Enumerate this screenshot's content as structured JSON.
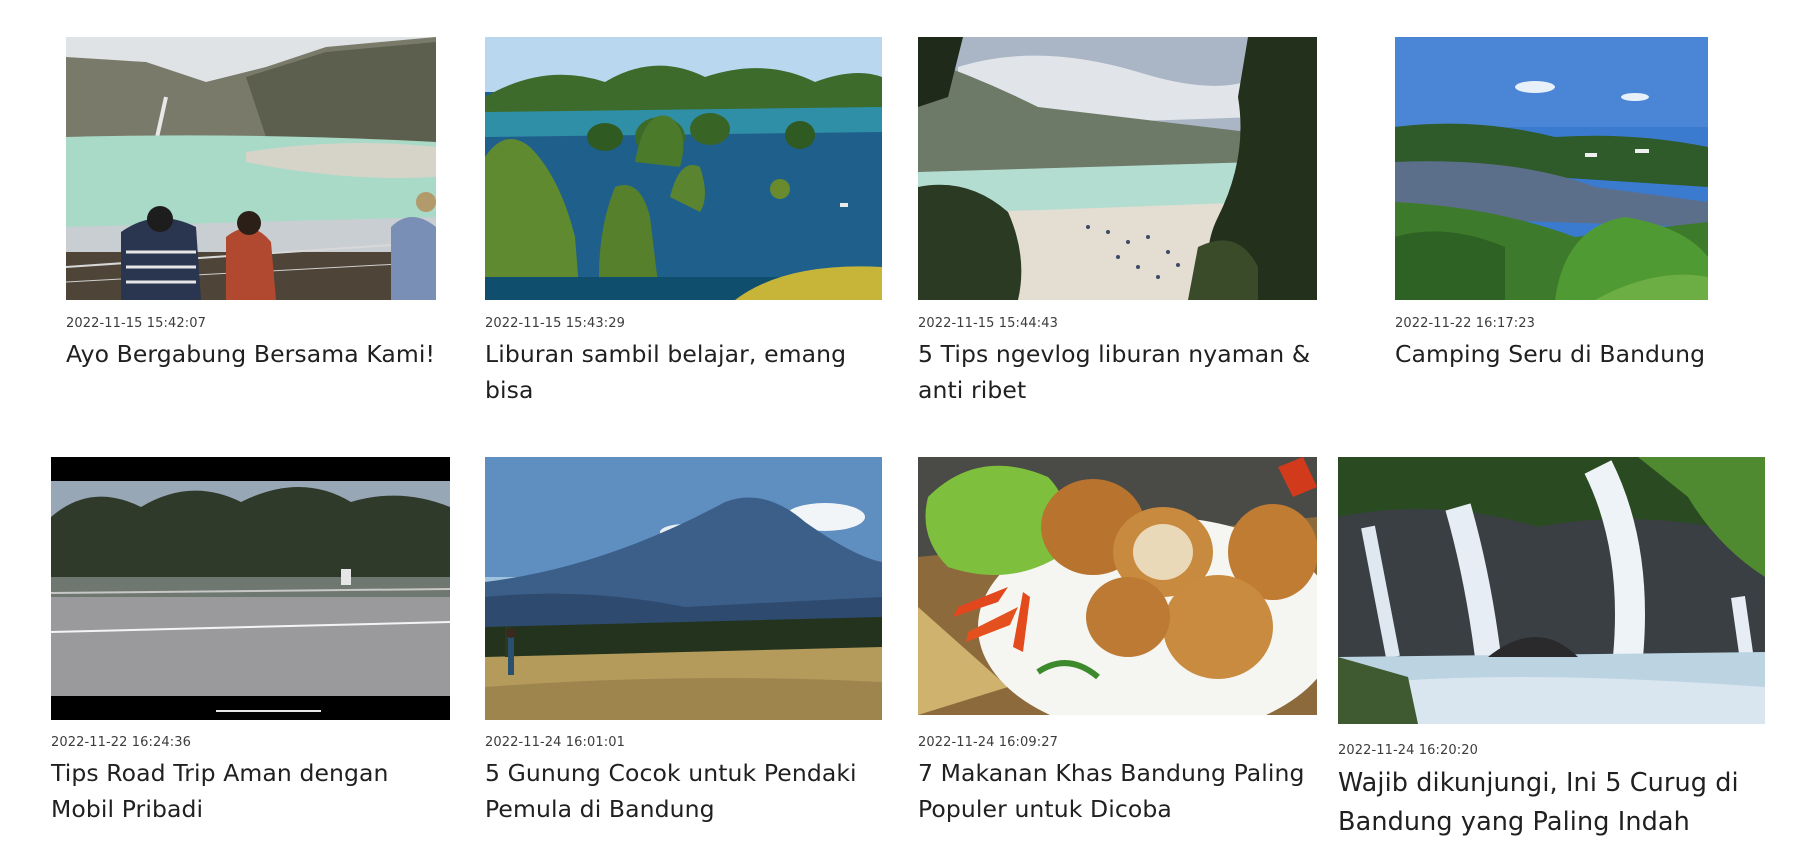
{
  "articles": [
    {
      "date": "2022-11-15 15:42:07",
      "title": "Ayo Bergabung Bersama Kami!",
      "image": "crater-lake-tourists-photo"
    },
    {
      "date": "2022-11-15 15:43:29",
      "title": "Liburan sambil belajar, emang bisa",
      "image": "karst-islands-bay-photo"
    },
    {
      "date": "2022-11-15 15:44:43",
      "title": "5 Tips ngevlog liburan nyaman & anti ribet",
      "image": "crater-beach-crowd-photo"
    },
    {
      "date": "2022-11-22 16:17:23",
      "title": "Camping Seru di Bandung",
      "image": "forest-lake-camp-photo"
    },
    {
      "date": "2022-11-22 16:24:36",
      "title": "Tips Road Trip Aman dengan Mobil Pribadi",
      "image": "roadside-trees-video-frame"
    },
    {
      "date": "2022-11-24 16:01:01",
      "title": "5 Gunung Cocok untuk Pendaki Pemula di Bandung",
      "image": "mountain-savanna-hiker-photo"
    },
    {
      "date": "2022-11-24 16:09:27",
      "title": "7 Makanan Khas Bandung Paling Populer untuk Dicoba",
      "image": "fried-tofu-plate-photo"
    },
    {
      "date": "2022-11-24 16:20:20",
      "title": "Wajib dikunjungi, Ini 5 Curug di Bandung yang Paling Indah",
      "image": "waterfall-cascade-photo"
    }
  ]
}
